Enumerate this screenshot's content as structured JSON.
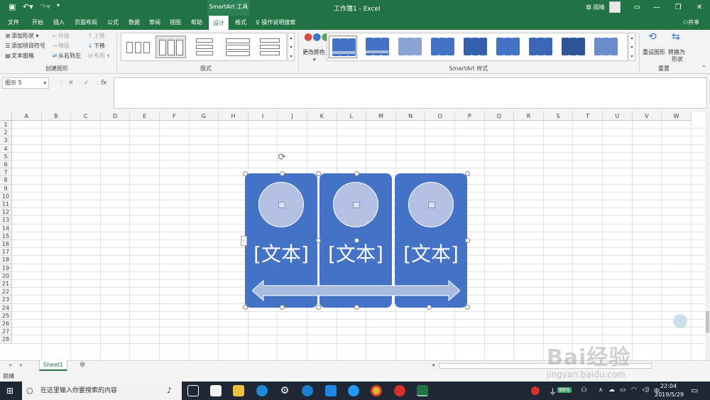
{
  "titlebar": {
    "app_title": "工作簿1 - Excel",
    "context_label": "SmartArt 工具",
    "user_name": "章 雨晴"
  },
  "tabs": [
    "文件",
    "开始",
    "插入",
    "页面布局",
    "公式",
    "数据",
    "审阅",
    "视图",
    "帮助",
    "设计",
    "格式"
  ],
  "active_tab": "设计",
  "tell_me": "操作说明搜索",
  "share": "共享",
  "ribbon": {
    "create_graphic": {
      "label": "创建图形",
      "add_shape": "添加形状",
      "add_bullet": "添加项目符号",
      "text_pane": "文本窗格",
      "promote": "升级",
      "demote": "降级",
      "right_to_left": "从右到左",
      "move_up": "上移",
      "move_down": "下移",
      "layout": "布局"
    },
    "layouts_label": "版式",
    "change_colors": "更改颜色",
    "styles_label": "SmartArt 样式",
    "reset": {
      "label": "重置",
      "reset_graphic": "重设图形",
      "convert_line1": "转换为",
      "convert_line2": "形状"
    }
  },
  "formula": {
    "name_box": "图示 5",
    "cancel": "✕",
    "enter": "✓",
    "fx": "fx"
  },
  "columns": [
    "A",
    "B",
    "C",
    "D",
    "E",
    "F",
    "G",
    "H",
    "I",
    "J",
    "K",
    "L",
    "M",
    "N",
    "O",
    "P",
    "Q",
    "R",
    "S",
    "T",
    "U",
    "V",
    "W"
  ],
  "rows": [
    "1",
    "2",
    "3",
    "4",
    "5",
    "6",
    "7",
    "8",
    "9",
    "10",
    "11",
    "12",
    "13",
    "14",
    "15",
    "16",
    "17",
    "18",
    "19",
    "20",
    "21",
    "22",
    "23",
    "24",
    "25",
    "26",
    "27",
    "28"
  ],
  "smartart": {
    "panels": [
      {
        "text": "[文本]"
      },
      {
        "text": "[文本]"
      },
      {
        "text": "[文本]"
      }
    ],
    "fill_color": "#4472c4",
    "circle_color": "#b4c1e2",
    "arrow_color": "#a9bce0"
  },
  "sheet_tab": "Sheet1",
  "status": "就绪",
  "taskbar": {
    "search_placeholder": "在这里输入你要搜索的内容",
    "battery": "96%",
    "ime": "中",
    "time": "22:04",
    "date": "2019/5/29"
  },
  "watermark": {
    "brand": "Bai经验",
    "url": "jingyan.baidu.com"
  },
  "colors": {
    "excel_green": "#217346",
    "accent_blue": "#4472c4"
  }
}
